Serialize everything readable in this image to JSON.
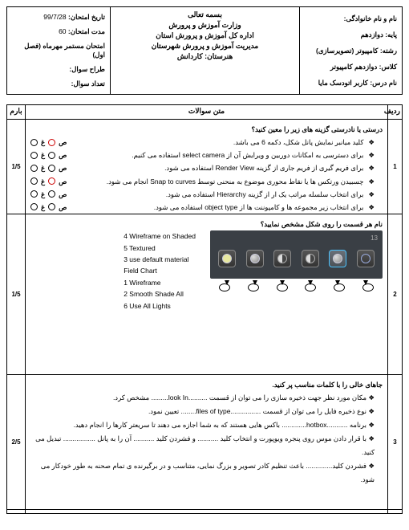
{
  "header": {
    "right": {
      "name_label": "نام و نام خانوادگی:",
      "grade_label": "پایه: دوازدهم",
      "field_label": "رشته: کامپیوتر (تصویرسازی)",
      "class_label": "کلاس: دوازدهم کامپیوتر",
      "course_label": "نام درس: کاربر اتودسک مایا"
    },
    "center": {
      "l1": "بسمه تعالی",
      "l2": "وزارت آموزش و پرورش",
      "l3": "اداره کل آموزش و پرورش استان",
      "l4": "مدیریت آموزش و پرورش شهرستان",
      "l5": "هنرستان: کاردانش"
    },
    "left": {
      "date_label": "تاریخ امتحان:",
      "date_value": "99/7/28",
      "dur_label": "مدت امتحان:",
      "dur_value": "60",
      "type_label": "امتحان مستمر مهرماه (فصل اول)",
      "designer_label": "طراح سوال:",
      "count_label": "تعداد سوال:"
    }
  },
  "columns": {
    "row_header": "ردیف",
    "main_header": "متن سوالات",
    "score_header": "بارم"
  },
  "q1": {
    "row": "1",
    "score": "1/5",
    "prompt": "درستی یا نادرستی گزینه های زیر را معین کنید؟",
    "s_label": "ص",
    "g_label": "غ",
    "items": [
      "کلید میانبر نمایش پانل شکل، دکمه 6 می باشد.",
      "برای دسترسی به امکانات دوربین و ویرایش آن از select camera استفاده می کنیم.",
      "برای فریم گیری از فریم جاری از گزینه Render View استفاده می شود.",
      "چسبیدن ورتکس ها یا نقاط محوری موضوع به منحنی توسط Snap to curves انجام می شود.",
      "برای انتخاب سلسله مراتب یک ار از گزینه Hierarchy استفاده می شود.",
      "برای انتخاب زیر مجموعه ها و کامپوننت ها از object type استفاده می شود."
    ]
  },
  "q2": {
    "row": "2",
    "score": "1/5",
    "prompt": "نام هر قسمت را روی شکل مشخص نمایید؟",
    "toolbar_label": "13",
    "options": [
      "4   Wireframe on Shaded",
      "5   Textured",
      "3 use default material",
      "Field Chart",
      "1   Wireframe",
      "2 Smooth Shade All",
      "6  Use All Lights"
    ]
  },
  "q3": {
    "row": "3",
    "score": "2/5",
    "prompt": "جاهای خالی را با کلمات مناسب پر کنید.",
    "items": [
      "مکان مورد نظر جهت ذخیره سازی را می توان از قسمت ..........look In......... مشخص کرد.",
      "نوع ذخیره فایل را می توان از قسمت ................files of type........ تعیین نمود.",
      "برنامه ...........hotbox............. باکس هایی هستند که به شما اجازه می دهند تا سریعتر کارها را انجام دهید.",
      "با قرار دادن موس روی پنجره ویوپورت و انتخاب کلید ........... و فشردن کلید ........... آن را به پانل ................. تبدیل می کنید.",
      "فشردن کلید.............. باعث تنظیم کادر تصویر و بزرگ نمایی، متناسب و در برگیرنده ی تمام صحنه به طور خودکار می شود."
    ]
  }
}
